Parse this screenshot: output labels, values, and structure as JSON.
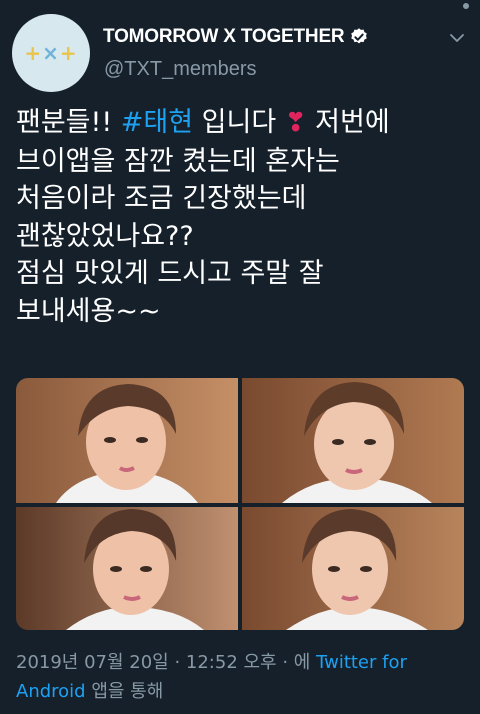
{
  "account": {
    "avatar_text": {
      "part1": "+",
      "part2": "×",
      "part3": "+"
    },
    "name": "TOMORROW X TOGETHER",
    "verified": true,
    "handle": "@TXT_members"
  },
  "icons": {
    "verified": "verified-badge-icon",
    "menu": "chevron-down-icon"
  },
  "tweet": {
    "line1_a": "팬분들!! ",
    "hashtag": "#태현",
    "line1_b": " 입니다",
    "heart": "❣",
    "line1_c": " 저번에",
    "rest": "브이앱을 잠깐 켰는데 혼자는\n처음이라 조금 긴장했는데\n괜찮았었나요??\n점심 맛있게 드시고 주말 잘\n보내세용~~"
  },
  "media": {
    "photo_count": 4,
    "photos": [
      {
        "name": "photo-1"
      },
      {
        "name": "photo-2"
      },
      {
        "name": "photo-3"
      },
      {
        "name": "photo-4"
      }
    ]
  },
  "meta": {
    "timestamp": "2019년 07월 20일 · 12:52 오후 · 에 ",
    "client": "Twitter for Android",
    "suffix": " 앱을 통해"
  },
  "colors": {
    "background": "#15202b",
    "link": "#1da1f2",
    "muted": "#8899a6",
    "heart": "#e0245e"
  }
}
